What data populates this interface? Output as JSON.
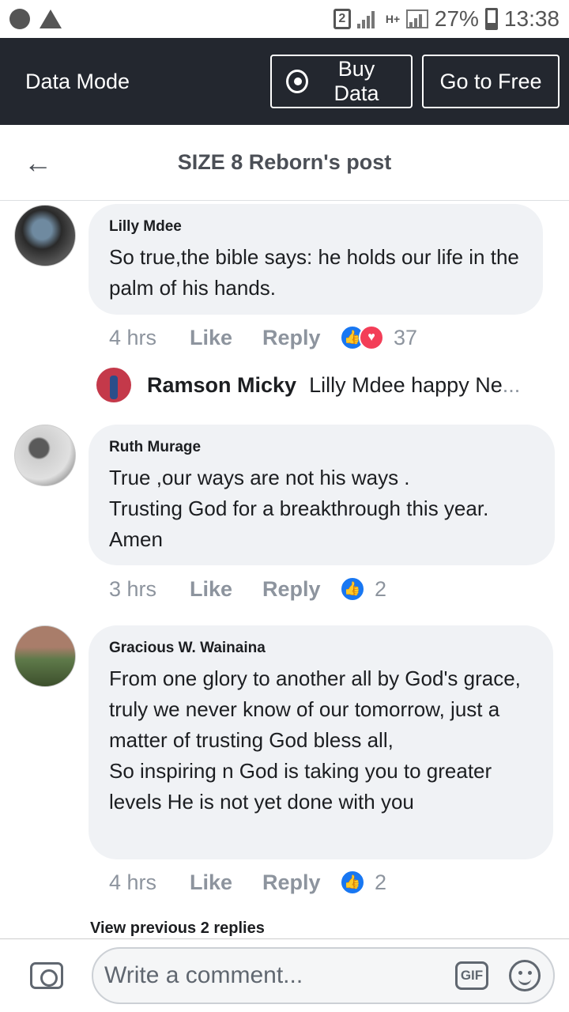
{
  "status_bar": {
    "sim_label": "2",
    "network_label": "H+",
    "battery": "27%",
    "time": "13:38"
  },
  "data_bar": {
    "mode_label": "Data Mode",
    "buy_label": "Buy Data",
    "free_label": "Go to Free"
  },
  "header": {
    "title": "SIZE 8 Reborn's post"
  },
  "comments": [
    {
      "author": "Lilly Mdee",
      "text": "So true,the bible says: he holds our life in the palm of his hands.",
      "time": "4 hrs",
      "like_label": "Like",
      "reply_label": "Reply",
      "reactions": [
        "like-icon",
        "love-icon"
      ],
      "reaction_count": "37"
    },
    {
      "author": "Ruth Murage",
      "text": "True ,our ways are not his ways .\nTrusting God for a breakthrough this year. Amen",
      "time": "3 hrs",
      "like_label": "Like",
      "reply_label": "Reply",
      "reactions": [
        "like-icon"
      ],
      "reaction_count": "2"
    },
    {
      "author": "Gracious W. Wainaina",
      "text": "From one glory to another all by God's grace, truly we never know of our tomorrow, just a matter of trusting God bless all,\nSo inspiring n God is taking you to greater levels He is not yet done with you",
      "time": "4 hrs",
      "like_label": "Like",
      "reply_label": "Reply",
      "reactions": [
        "like-icon"
      ],
      "reaction_count": "2"
    }
  ],
  "reply_preview": {
    "name": "Ramson Micky",
    "text": "Lilly Mdee happy Ne",
    "ellipsis": "..."
  },
  "view_previous": "View previous 2 replies",
  "composer": {
    "placeholder": "Write a comment...",
    "gif_label": "GIF"
  },
  "colors": {
    "data_bar_bg": "#23272f",
    "bubble_bg": "#f0f2f5",
    "like_blue": "#1877f2",
    "love_red": "#f33e58",
    "meta_gray": "#8d949e"
  }
}
